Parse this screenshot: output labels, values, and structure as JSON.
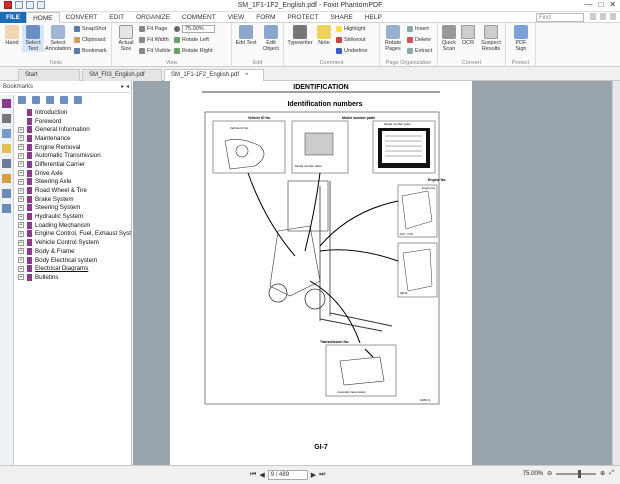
{
  "window": {
    "title": "SM_1F1-1F2_English.pdf - Foxit PhantomPDF"
  },
  "menu": {
    "items": [
      "FILE",
      "HOME",
      "CONVERT",
      "EDIT",
      "ORGANIZE",
      "COMMENT",
      "VIEW",
      "FORM",
      "PROTECT",
      "SHARE",
      "HELP"
    ],
    "search_placeholder": "Find"
  },
  "ribbon": {
    "tools": {
      "hand": "Hand",
      "select_text": "Select Text",
      "select_annotation": "Select Annotation",
      "snapshot": "SnapShot",
      "clipboard": "Clipboard",
      "bookmark": "Bookmark",
      "group": "Tools"
    },
    "view": {
      "actual_size": "Actual Size",
      "fit_page": "Fit Page",
      "fit_width": "Fit Width",
      "fit_visible": "Fit Visible",
      "zoom": "75.00%",
      "rotate_left": "Rotate Left",
      "rotate_right": "Rotate Right",
      "group": "View"
    },
    "edit": {
      "edit_text": "Edit Text",
      "edit_object": "Edit Object",
      "group": "Edit"
    },
    "comment": {
      "typewriter": "Typewriter",
      "note": "Note",
      "highlight": "Highlight",
      "strikeout": "Strikeout",
      "underline": "Underline",
      "group": "Comment"
    },
    "page_org": {
      "rotate_pages": "Rotate Pages",
      "insert": "Insert",
      "delete": "Delete",
      "extract": "Extract",
      "group": "Page Organization"
    },
    "convert": {
      "quick_scan": "Quick Scan",
      "ocr": "OCR",
      "suspect_results": "Suspect Results",
      "group": "Convert"
    },
    "protect": {
      "pdf_sign": "PDF Sign",
      "group": "Protect"
    }
  },
  "tabs": [
    {
      "label": "Start"
    },
    {
      "label": "SM_F03_English.pdf"
    },
    {
      "label": "SM_1F1-1F2_English.pdf"
    }
  ],
  "sidebar": {
    "title": "Bookmarks",
    "bookmarks": [
      {
        "label": "Introduction",
        "expandable": false
      },
      {
        "label": "Foreword",
        "expandable": false
      },
      {
        "label": "General Information",
        "expandable": true
      },
      {
        "label": "Maintenance",
        "expandable": true
      },
      {
        "label": "Engine Removal",
        "expandable": true
      },
      {
        "label": "Automatic Transmission",
        "expandable": true
      },
      {
        "label": "Differential Carrier",
        "expandable": true
      },
      {
        "label": "Drive Axle",
        "expandable": true
      },
      {
        "label": "Steering Axle",
        "expandable": true
      },
      {
        "label": "Road Wheel & Tire",
        "expandable": true
      },
      {
        "label": "Brake System",
        "expandable": true
      },
      {
        "label": "Steering System",
        "expandable": true
      },
      {
        "label": "Hydraulic System",
        "expandable": true
      },
      {
        "label": "Loading Mechanism",
        "expandable": true
      },
      {
        "label": "Engine Control, Fuel, Exhaust Syst",
        "expandable": true
      },
      {
        "label": "Vehicle Control System",
        "expandable": true
      },
      {
        "label": "Body & Frame",
        "expandable": true
      },
      {
        "label": "Body Electrical system",
        "expandable": true
      },
      {
        "label": "Electrical Diagrams",
        "expandable": true
      },
      {
        "label": "Bulletins",
        "expandable": true
      }
    ]
  },
  "document": {
    "header": "IDENTIFICATION",
    "heading": "Identification numbers",
    "labels": {
      "vehicle_id": "Vehicle ID No.",
      "vehicle_id_inner": "Vehicle ID No.",
      "model_plate": "Model number plate",
      "model_plate_inner": "Model number plate",
      "model_plate_caption": "Model number plate",
      "engine": "Engine No.",
      "engine_inner": "Engine No.",
      "k21": "K21 · K25",
      "qd32": "QD32",
      "transmission": "Transmission No.",
      "auto_trans": "Automatic transmission",
      "ref": "GIM0171"
    },
    "page_label": "GI-7"
  },
  "status": {
    "page": "9 / 489",
    "zoom": "75.00%"
  }
}
